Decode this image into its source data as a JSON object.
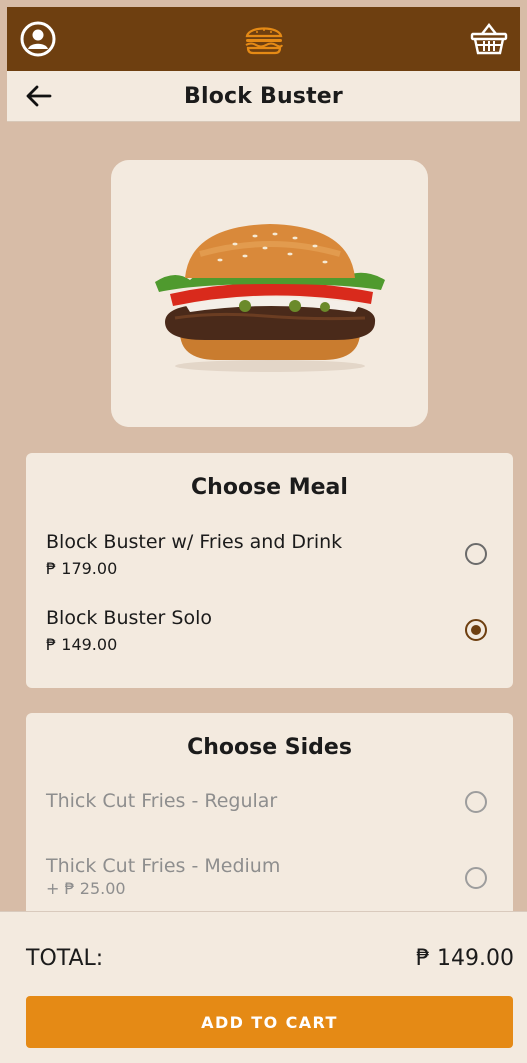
{
  "app": {
    "colors": {
      "brand": "#6e3f10",
      "accent": "#e58a15",
      "page_bg": "#d7bca7",
      "card_bg": "#f3eadf"
    }
  },
  "header": {
    "icons": [
      "account-icon",
      "burger-logo-icon",
      "basket-icon"
    ],
    "title": "Block Buster"
  },
  "meal": {
    "title": "Choose Meal",
    "options": [
      {
        "name": "Block Buster w/ Fries and Drink",
        "price": "₱ 179.00",
        "selected": false
      },
      {
        "name": "Block Buster Solo",
        "price": "₱ 149.00",
        "selected": true
      }
    ]
  },
  "sides": {
    "title": "Choose Sides",
    "options": [
      {
        "name": "Thick Cut Fries - Regular",
        "price": "",
        "selected": false
      },
      {
        "name": "Thick Cut Fries - Medium",
        "price": "+ ₱ 25.00",
        "selected": false
      }
    ]
  },
  "footer": {
    "total_label": "TOTAL:",
    "total_amount": "₱ 149.00",
    "cart_button": "ADD TO CART"
  }
}
